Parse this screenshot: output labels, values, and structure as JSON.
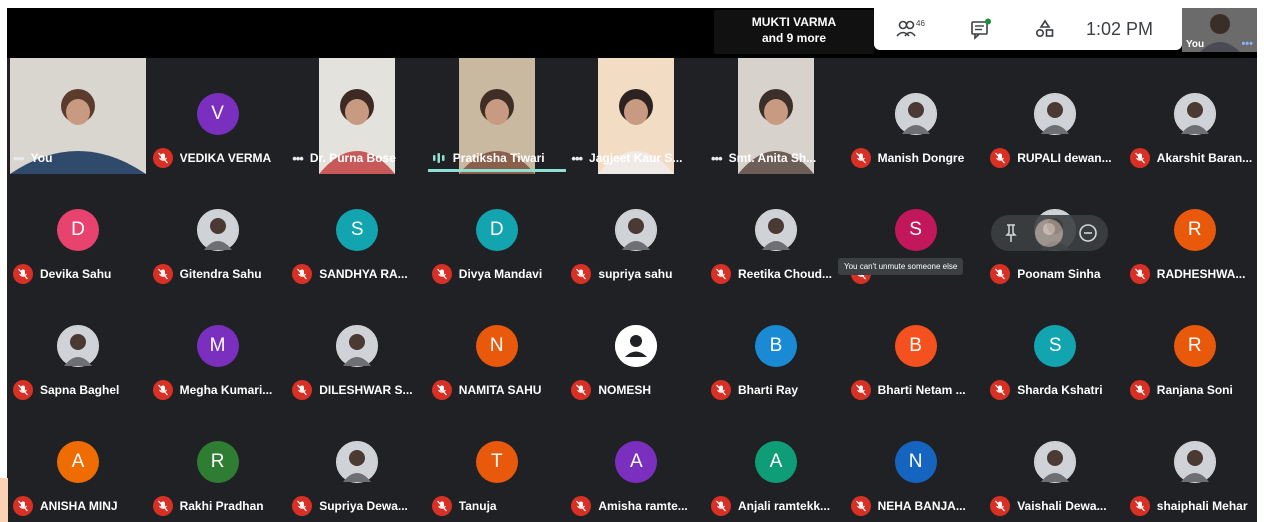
{
  "top_bar": {
    "speaker": {
      "line1": "MUKTI VARMA",
      "line2": "and 9 more"
    },
    "people_count": "46",
    "clock": "1:02 PM",
    "self_thumbnail": "You"
  },
  "tooltip": "You can't unmute someone else",
  "colors": {
    "background": "#202124",
    "mic_off": "#d93025",
    "speaking": "#8ee0d4"
  },
  "row1": [
    {
      "name": "You",
      "kind": "video",
      "ind": "dots"
    },
    {
      "name": "VEDIKA VERMA",
      "kind": "letter",
      "letter": "V",
      "color": "#7b2fbf",
      "ind": "mic"
    },
    {
      "name": "Dr. Purna Bose",
      "kind": "video",
      "ind": "dots"
    },
    {
      "name": "Pratiksha Tiwari",
      "kind": "video",
      "ind": "wave",
      "speaking": true
    },
    {
      "name": "Jagjeet Kaur S...",
      "kind": "video",
      "ind": "dots"
    },
    {
      "name": "Smt. Anita Sh...",
      "kind": "video",
      "ind": "dots"
    },
    {
      "name": "Manish Dongre",
      "kind": "photo",
      "ind": "mic"
    },
    {
      "name": "RUPALI dewan...",
      "kind": "photo",
      "ind": "mic"
    },
    {
      "name": "Akarshit Baran...",
      "kind": "photo",
      "ind": "mic"
    }
  ],
  "row2": [
    {
      "name": "Devika Sahu",
      "kind": "letter",
      "letter": "D",
      "color": "#e8436e",
      "ind": "mic"
    },
    {
      "name": "Gitendra Sahu",
      "kind": "photo",
      "ind": "mic"
    },
    {
      "name": "SANDHYA RA...",
      "kind": "letter",
      "letter": "S",
      "color": "#12a4af",
      "ind": "mic"
    },
    {
      "name": "Divya Mandavi",
      "kind": "letter",
      "letter": "D",
      "color": "#12a4af",
      "ind": "mic"
    },
    {
      "name": "supriya sahu",
      "kind": "photo",
      "ind": "mic"
    },
    {
      "name": "Reetika Choud...",
      "kind": "photo",
      "ind": "mic"
    },
    {
      "name": "",
      "kind": "letter",
      "letter": "S",
      "color": "#c2185b",
      "ind": "mic"
    },
    {
      "name": "Poonam Sinha",
      "kind": "photo",
      "ind": "mic"
    },
    {
      "name": "RADHESHWA...",
      "kind": "letter",
      "letter": "R",
      "color": "#e8590c",
      "ind": "mic"
    }
  ],
  "row3": [
    {
      "name": "Sapna Baghel",
      "kind": "photo",
      "ind": "mic"
    },
    {
      "name": "Megha Kumari...",
      "kind": "letter",
      "letter": "M",
      "color": "#7b2fbf",
      "ind": "mic"
    },
    {
      "name": "DILESHWAR S...",
      "kind": "photo",
      "ind": "mic"
    },
    {
      "name": "NAMITA SAHU",
      "kind": "letter",
      "letter": "N",
      "color": "#e8590c",
      "ind": "mic"
    },
    {
      "name": "NOMESH",
      "kind": "noicon",
      "ind": "mic"
    },
    {
      "name": "Bharti Ray",
      "kind": "letter",
      "letter": "B",
      "color": "#1a8ad4",
      "ind": "mic"
    },
    {
      "name": "Bharti Netam ...",
      "kind": "letter",
      "letter": "B",
      "color": "#f4511e",
      "ind": "mic"
    },
    {
      "name": "Sharda Kshatri",
      "kind": "letter",
      "letter": "S",
      "color": "#12a4af",
      "ind": "mic"
    },
    {
      "name": "Ranjana Soni",
      "kind": "letter",
      "letter": "R",
      "color": "#e8590c",
      "ind": "mic"
    }
  ],
  "row4": [
    {
      "name": "ANISHA MINJ",
      "kind": "letter",
      "letter": "A",
      "color": "#ef6c00",
      "ind": "mic"
    },
    {
      "name": "Rakhi Pradhan",
      "kind": "letter",
      "letter": "R",
      "color": "#2e7d32",
      "ind": "mic"
    },
    {
      "name": "Supriya Dewa...",
      "kind": "photo",
      "ind": "mic"
    },
    {
      "name": "Tanuja",
      "kind": "letter",
      "letter": "T",
      "color": "#e8590c",
      "ind": "mic"
    },
    {
      "name": "Amisha ramte...",
      "kind": "letter",
      "letter": "A",
      "color": "#7b2fbf",
      "ind": "mic"
    },
    {
      "name": "Anjali ramtekk...",
      "kind": "letter",
      "letter": "A",
      "color": "#0f9d78",
      "ind": "mic"
    },
    {
      "name": "NEHA BANJA...",
      "kind": "letter",
      "letter": "N",
      "color": "#1565c0",
      "ind": "mic"
    },
    {
      "name": "Vaishali Dewa...",
      "kind": "photo",
      "ind": "mic"
    },
    {
      "name": "shaiphali Mehar",
      "kind": "photo",
      "ind": "mic"
    }
  ]
}
